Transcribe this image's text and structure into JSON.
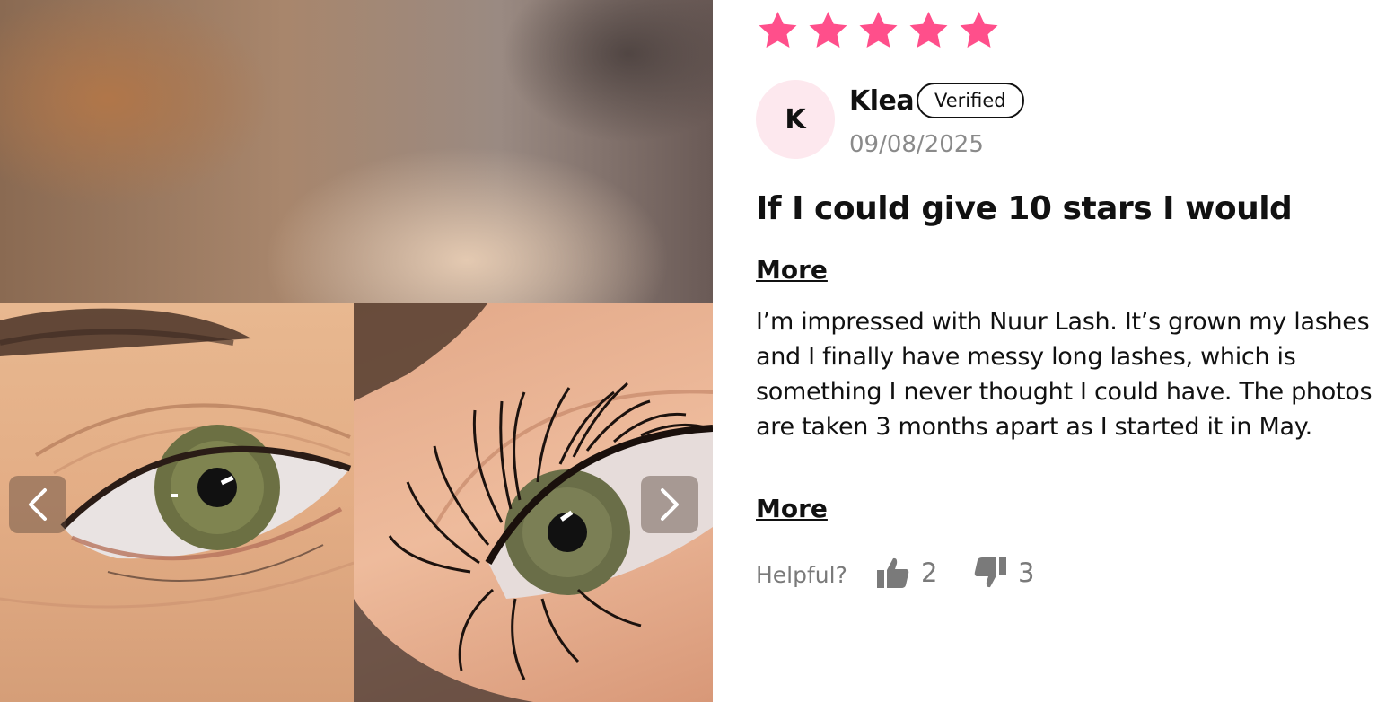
{
  "review": {
    "rating": 5,
    "rating_max": 5,
    "star_color": "#ff4f8b",
    "avatar_initial": "K",
    "author": "Klea",
    "verified_label": "Verified",
    "date": "09/08/2025",
    "title": "If I could give 10 stars I would",
    "more_label": "More",
    "body": "I’m impressed with Nuur Lash. It’s grown my lashes and I finally have messy long lashes, which is something I never thought I could have. The photos are taken 3 months apart as I started it in May.",
    "helpful_label": "Helpful?",
    "upvotes": "2",
    "downvotes": "3"
  },
  "gallery": {
    "prev_icon": "chevron-left-icon",
    "next_icon": "chevron-right-icon"
  }
}
